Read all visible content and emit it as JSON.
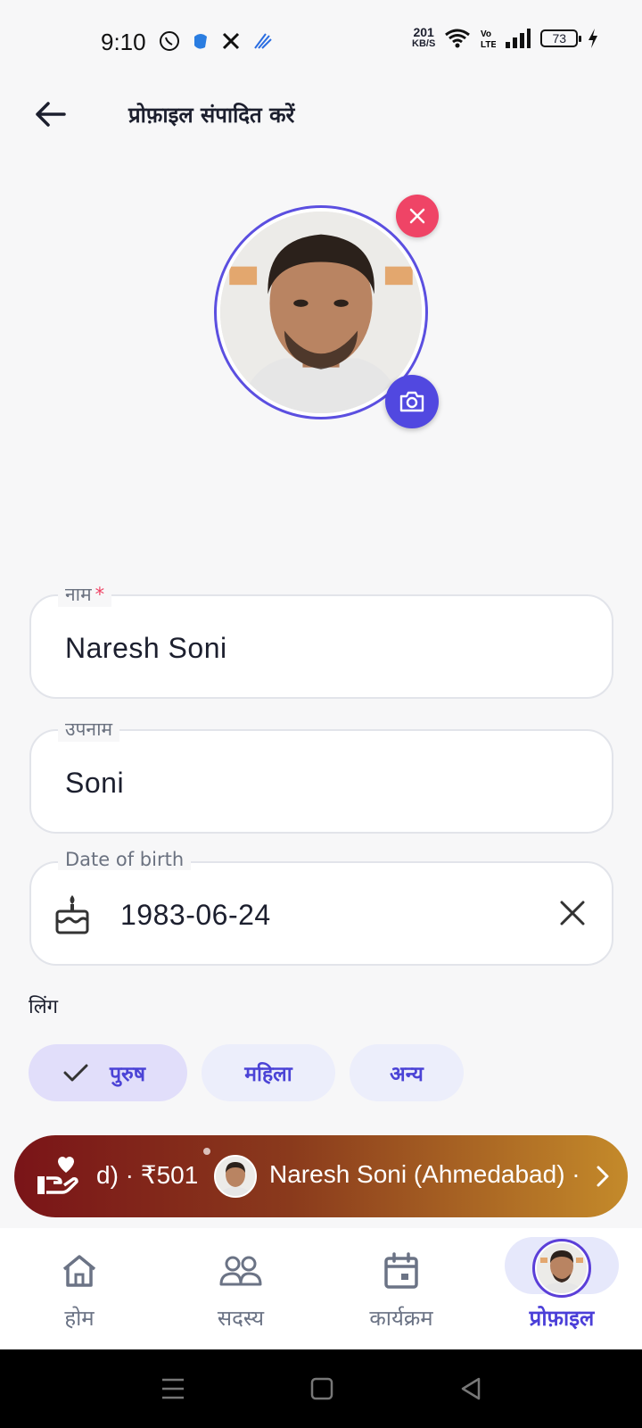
{
  "status_bar": {
    "time": "9:10",
    "net_speed_value": "201",
    "net_speed_unit": "KB/S",
    "battery": "73",
    "left_icons": [
      "whatsapp-icon",
      "app-icon",
      "x-icon",
      "signal-app-icon"
    ],
    "right_icons": [
      "wifi-icon",
      "volte-icon",
      "signal-bars-icon",
      "charging-icon"
    ]
  },
  "header": {
    "title": "प्रोफ़ाइल संपादित करें"
  },
  "form": {
    "name": {
      "label": "नाम",
      "required_mark": "*",
      "value": "Naresh Soni"
    },
    "surname": {
      "label": "उपनाम",
      "value": "Soni"
    },
    "dob": {
      "label": "Date of birth",
      "value": "1983-06-24"
    },
    "gender": {
      "label": "लिंग",
      "options": [
        "पुरुष",
        "महिला",
        "अन्य"
      ],
      "selected": "पुरुष"
    }
  },
  "ticker": {
    "amount_text": "d) · ₹501",
    "donor_text": "Naresh Soni (Ahmedabad) ·",
    "colors": [
      "#7a1418",
      "#c48a2a"
    ]
  },
  "bottom_nav": {
    "items": [
      {
        "label": "होम",
        "icon": "home-icon"
      },
      {
        "label": "सदस्य",
        "icon": "members-icon"
      },
      {
        "label": "कार्यक्रम",
        "icon": "calendar-icon"
      },
      {
        "label": "प्रोफ़ाइल",
        "icon": "avatar"
      }
    ],
    "active": "प्रोफ़ाइल"
  },
  "theme": {
    "accent": "#5148e0",
    "danger": "#ef4466"
  }
}
